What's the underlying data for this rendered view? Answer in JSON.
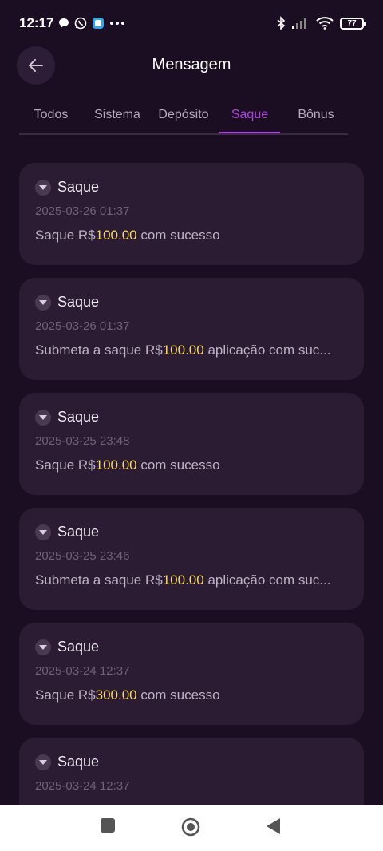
{
  "status": {
    "time": "12:17",
    "battery": "77"
  },
  "header": {
    "title": "Mensagem"
  },
  "tabs": [
    {
      "label": "Todos"
    },
    {
      "label": "Sistema"
    },
    {
      "label": "Depósito"
    },
    {
      "label": "Saque",
      "active": true
    },
    {
      "label": "Bônus"
    }
  ],
  "messages": [
    {
      "title": "Saque",
      "date": "2025-03-26 01:37",
      "pre": "Saque R$",
      "amount": "100.00",
      "post": " com sucesso"
    },
    {
      "title": "Saque",
      "date": "2025-03-26 01:37",
      "pre": "Submeta a saque R$",
      "amount": "100.00",
      "post": " aplicação com suc..."
    },
    {
      "title": "Saque",
      "date": "2025-03-25 23:48",
      "pre": "Saque R$",
      "amount": "100.00",
      "post": " com sucesso"
    },
    {
      "title": "Saque",
      "date": "2025-03-25 23:46",
      "pre": "Submeta a saque R$",
      "amount": "100.00",
      "post": " aplicação com suc..."
    },
    {
      "title": "Saque",
      "date": "2025-03-24 12:37",
      "pre": "Saque R$",
      "amount": "300.00",
      "post": " com sucesso"
    },
    {
      "title": "Saque",
      "date": "2025-03-24 12:37",
      "pre": "",
      "amount": "",
      "post": ""
    }
  ],
  "colors": {
    "accent": "#b342e6",
    "amount": "#f6d86b",
    "background": "#1b0d22",
    "card": "#2b1b33"
  }
}
